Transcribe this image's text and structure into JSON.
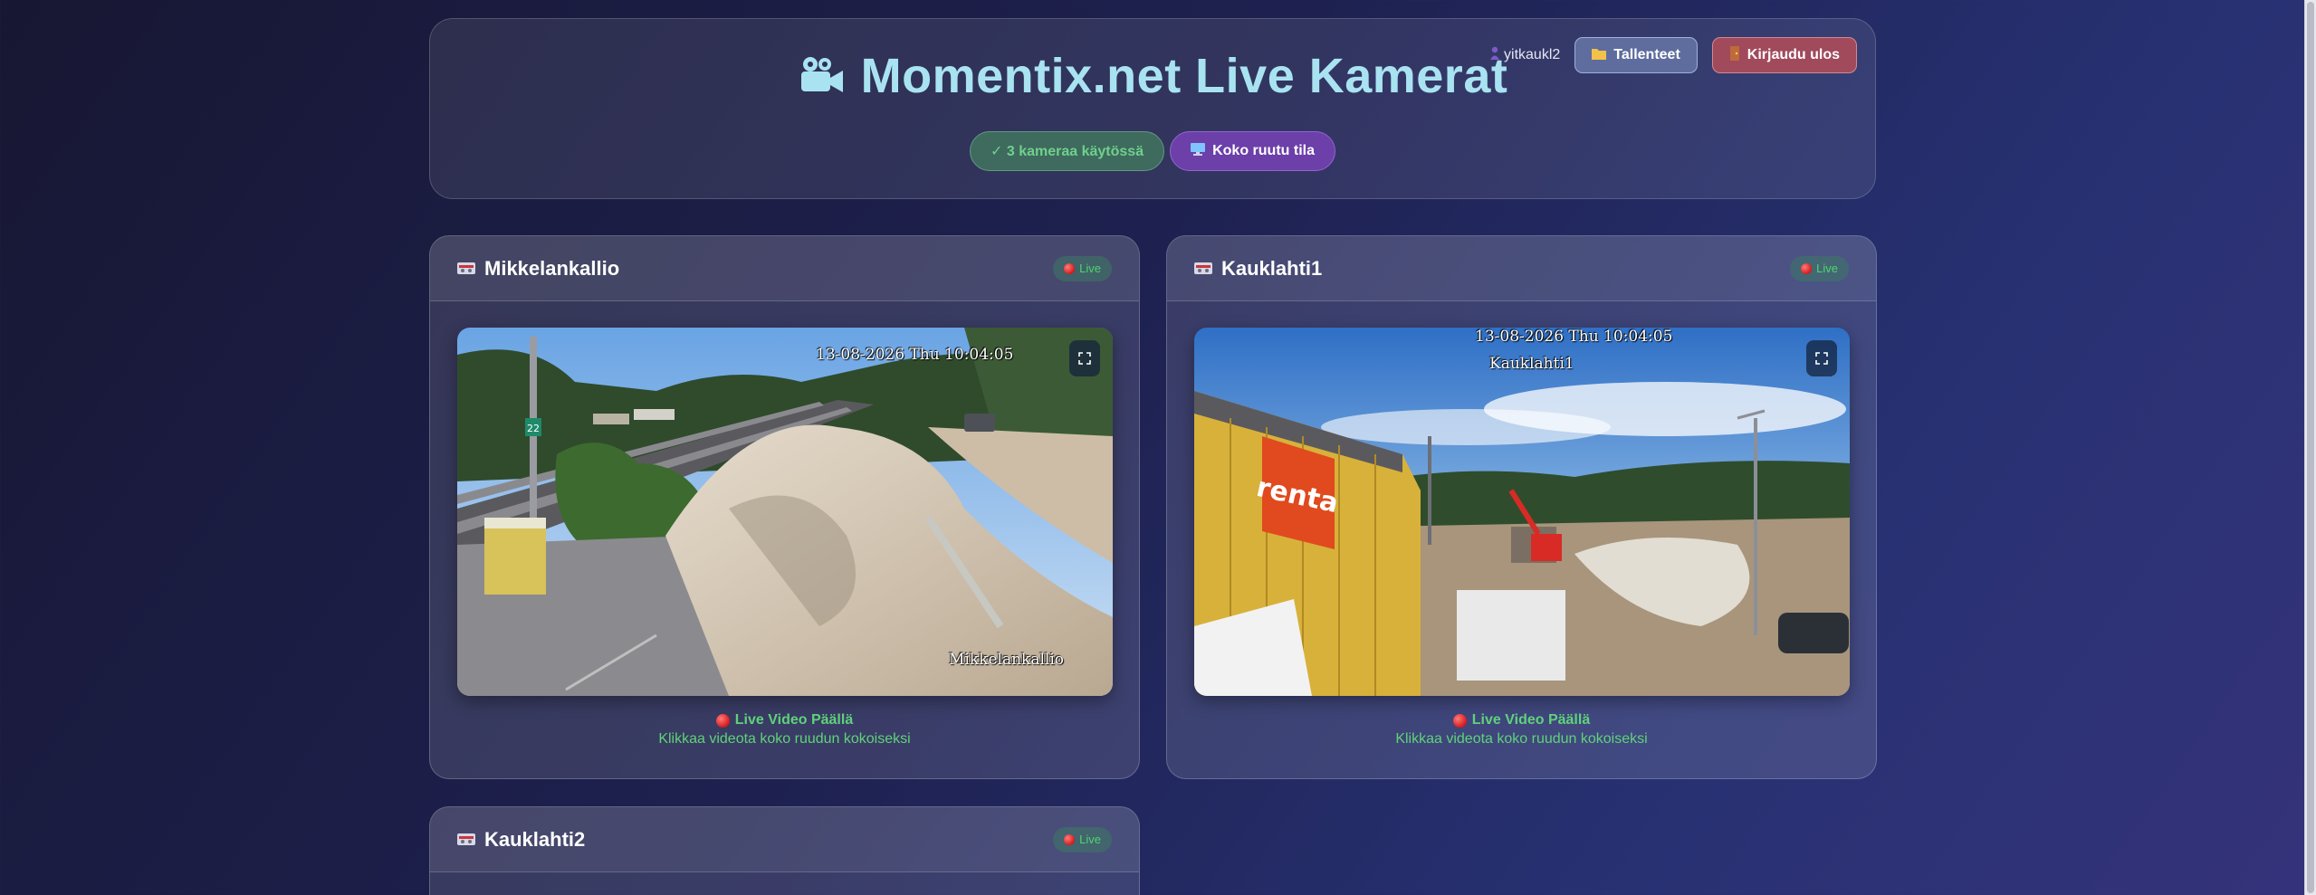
{
  "header": {
    "title": "Momentix.net Live Kamerat",
    "user": "yitkaukl2",
    "recordings_label": "Tallenteet",
    "logout_label": "Kirjaudu ulos",
    "status_label": "✓ 3 kameraa käytössä",
    "fullscreen_label": "Koko ruutu tila"
  },
  "cameras": [
    {
      "name": "Mikkelankallio",
      "badge": "Live",
      "timestamp": "13-08-2026 Thu 10:04:05",
      "overlay": "Mikkelankallio",
      "video_status": "Live Video Päällä",
      "video_hint": "Klikkaa videota koko ruudun kokoiseksi"
    },
    {
      "name": "Kauklahti1",
      "badge": "Live",
      "timestamp": "13-08-2026 Thu 10:04:05",
      "overlay": "Kauklahti1",
      "video_status": "Live Video Päällä",
      "video_hint": "Klikkaa videota koko ruudun kokoiseksi"
    },
    {
      "name": "Kauklahti2",
      "badge": "Live"
    }
  ],
  "signage": {
    "rental_logo": "renta",
    "track_sign": "22"
  },
  "colors": {
    "title": "#a9e3f1",
    "live_green": "#5fd27a",
    "fullscreen_purple": "#6c3fa9",
    "logout_red": "#a04a5b"
  }
}
